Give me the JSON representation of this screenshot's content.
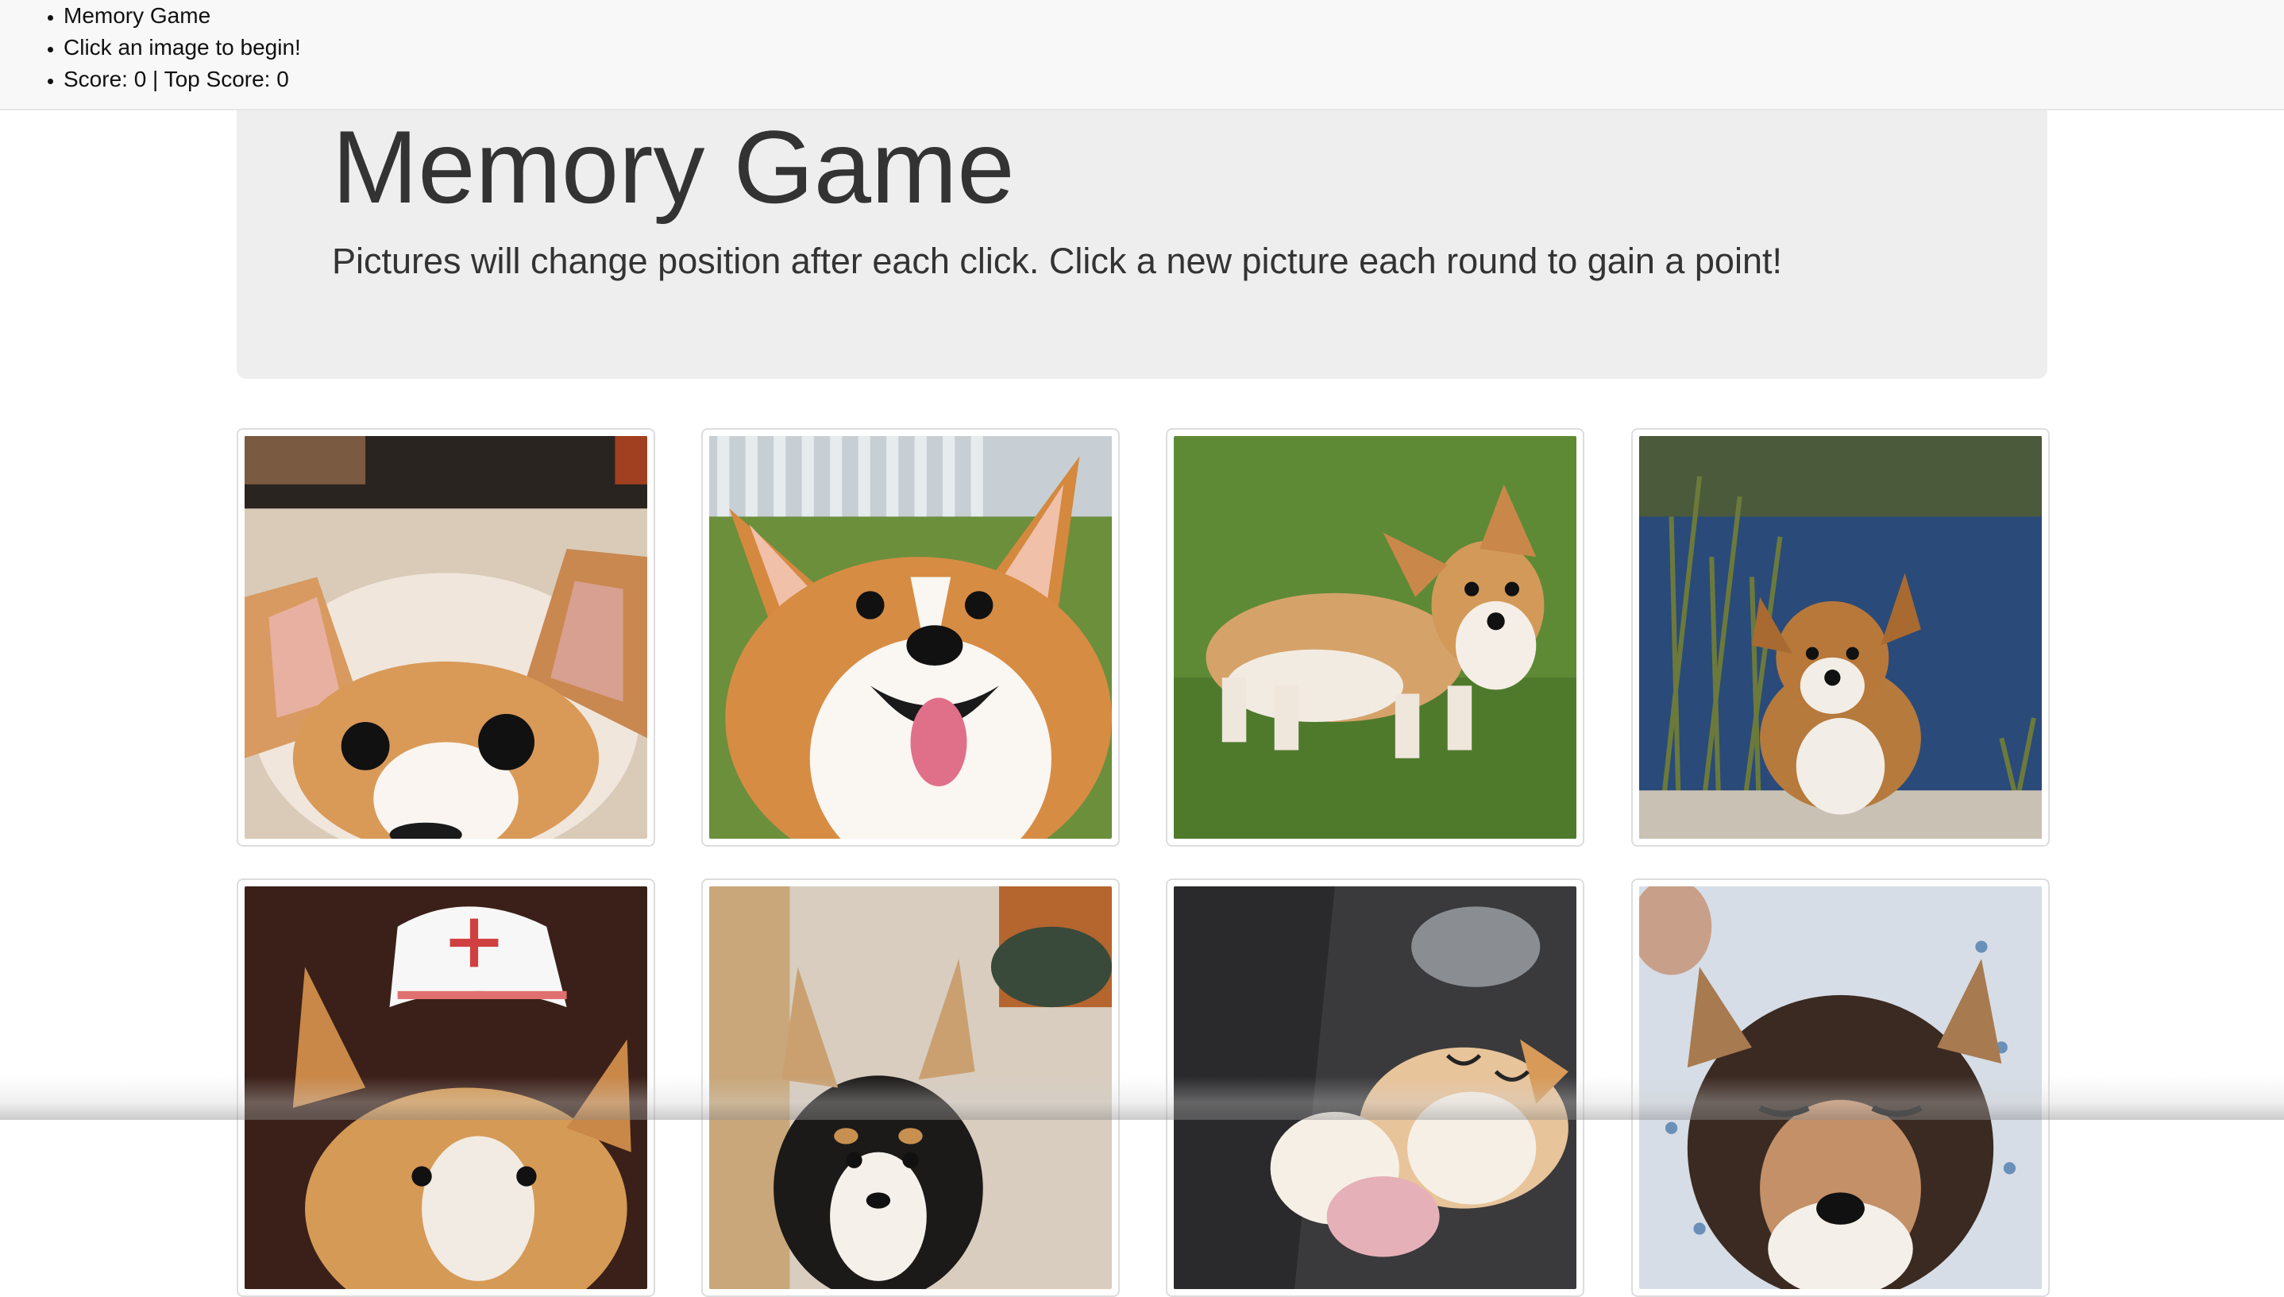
{
  "nav": {
    "items": [
      {
        "label": "Memory Game"
      },
      {
        "label": "Click an image to begin!"
      },
      {
        "label": "Score: 0 | Top Score: 0"
      }
    ]
  },
  "header": {
    "title": "Memory Game",
    "subtitle": "Pictures will change position after each click. Click a new picture each round to gain a point!"
  },
  "tiles": [
    {
      "alt": "corgi close-up face"
    },
    {
      "alt": "smiling corgi on grass"
    },
    {
      "alt": "corgi standing on lawn"
    },
    {
      "alt": "corgi puppy by pond"
    },
    {
      "alt": "corgi in nurse hat"
    },
    {
      "alt": "tricolor corgi puppy on porch"
    },
    {
      "alt": "corgi puppy sleeping in car"
    },
    {
      "alt": "tricolor corgi squinting"
    }
  ],
  "colors": {
    "navbar_bg": "#f8f8f8",
    "jumbotron_bg": "#eeeeee",
    "tile_border": "#dddddd"
  }
}
